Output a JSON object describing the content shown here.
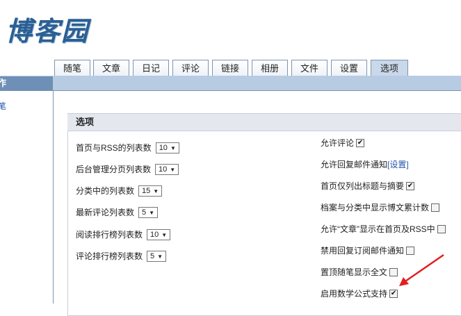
{
  "logo": "博客园",
  "tabs": [
    "随笔",
    "文章",
    "日记",
    "评论",
    "链接",
    "相册",
    "文件",
    "设置",
    "选项"
  ],
  "active_tab": "选项",
  "left_header": "作",
  "left_link": "笔",
  "panel_title": "选项",
  "left_settings": [
    {
      "label": "首页与RSS的列表数",
      "value": "10"
    },
    {
      "label": "后台管理分页列表数",
      "value": "10"
    },
    {
      "label": "分类中的列表数",
      "value": "15"
    },
    {
      "label": "最新评论列表数",
      "value": "5"
    },
    {
      "label": "阅读排行榜列表数",
      "value": "10"
    },
    {
      "label": "评论排行榜列表数",
      "value": "5"
    }
  ],
  "right_settings": {
    "allow_comment": {
      "label": "允许评论",
      "checked": true
    },
    "reply_email": {
      "label": "允许回复邮件通知",
      "link": "[设置]"
    },
    "home_title_only": {
      "label": "首页仅列出标题与摘要",
      "checked": true
    },
    "archive_count": {
      "label": "档案与分类中显示博文累计数",
      "checked": false
    },
    "article_home_rss": {
      "label": "允许“文章”显示在首页及RSS中",
      "checked": false
    },
    "disable_sub_email": {
      "label": "禁用回复订阅邮件通知",
      "checked": false
    },
    "top_post_full": {
      "label": "置顶随笔显示全文",
      "checked": false
    },
    "math_formula": {
      "label": "启用数学公式支持",
      "checked": true
    }
  },
  "colors": {
    "annotation_arrow": "#e02020",
    "header_bar": "#b7cbe3",
    "accent": "#2a5f93"
  }
}
